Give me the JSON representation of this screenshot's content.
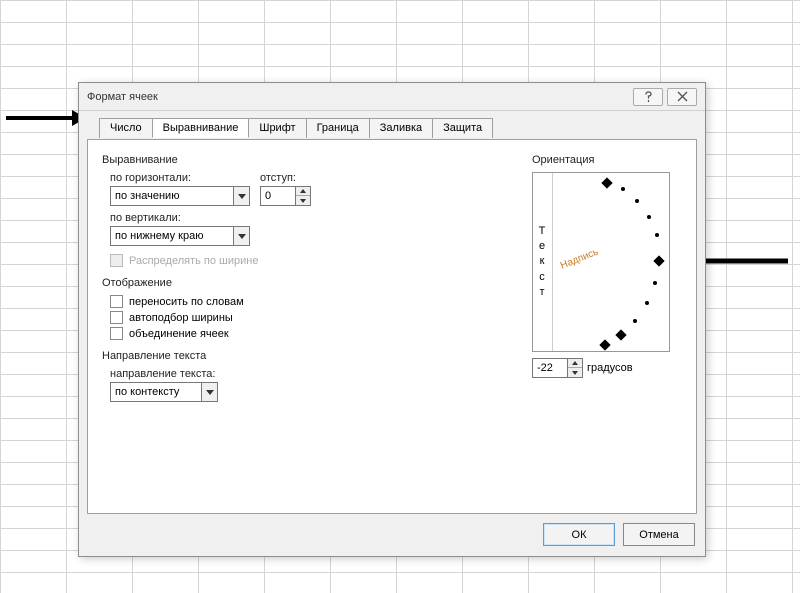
{
  "dialog": {
    "title": "Формат ячеек"
  },
  "tabs": [
    "Число",
    "Выравнивание",
    "Шрифт",
    "Граница",
    "Заливка",
    "Защита"
  ],
  "active_tab": 1,
  "alignment": {
    "section": "Выравнивание",
    "horizontal_label": "по горизонтали:",
    "horizontal_value": "по значению",
    "indent_label": "отступ:",
    "indent_value": "0",
    "vertical_label": "по вертикали:",
    "vertical_value": "по нижнему краю",
    "justify_distributed": "Распределять по ширине"
  },
  "display": {
    "section": "Отображение",
    "wrap": "переносить по словам",
    "shrink": "автоподбор ширины",
    "merge": "объединение ячеек"
  },
  "text_direction": {
    "section": "Направление текста",
    "label": "направление текста:",
    "value": "по контексту"
  },
  "orientation": {
    "section": "Ориентация",
    "vertical_text": "Текст",
    "label_text": "Надпись",
    "degrees_value": "-22",
    "degrees_label": "градусов"
  },
  "buttons": {
    "ok": "ОК",
    "cancel": "Отмена"
  }
}
